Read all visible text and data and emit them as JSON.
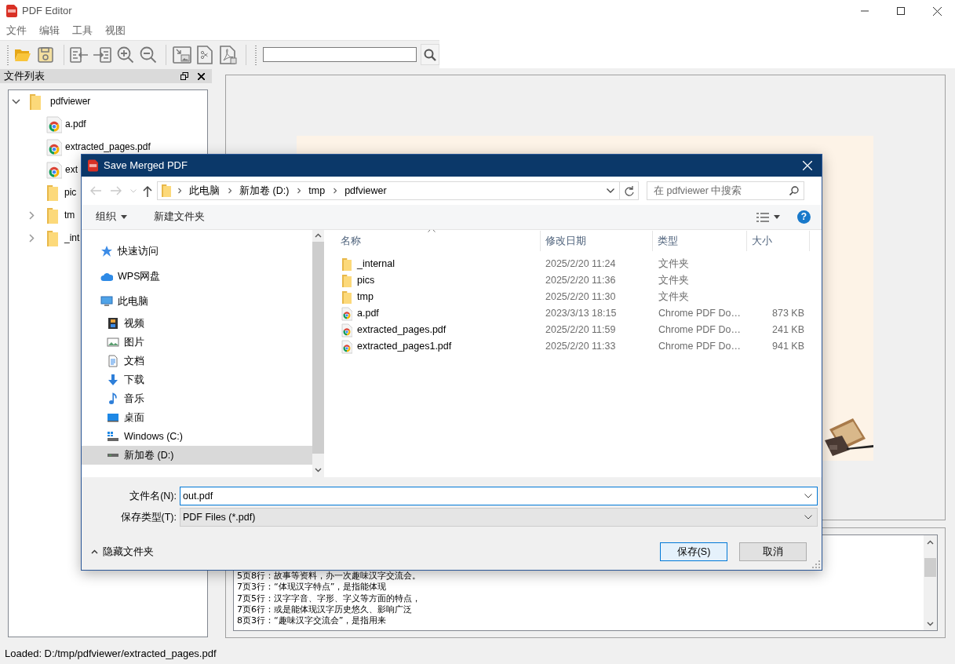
{
  "window": {
    "title": "PDF Editor"
  },
  "menu": [
    "文件",
    "编辑",
    "工具",
    "视图"
  ],
  "dock": {
    "title": "文件列表",
    "tree": [
      {
        "label": "pdfviewer",
        "kind": "folder",
        "expanded": true,
        "children": [
          {
            "label": "a.pdf",
            "kind": "pdf"
          },
          {
            "label": "extracted_pages.pdf",
            "kind": "pdf"
          },
          {
            "label": "ext",
            "kind": "pdf"
          },
          {
            "label": "pic",
            "kind": "folder"
          },
          {
            "label": "tm",
            "kind": "folder",
            "expanded": false
          },
          {
            "label": "_int",
            "kind": "folder",
            "expanded": false
          }
        ]
      }
    ]
  },
  "log": {
    "lines": [
      "5页8行：故事等资料，办一次趣味汉字交流会。",
      "7页3行：“体现汉字特点”，是指能体现",
      "7页5行：汉字字音、字形、字义等方面的特点，",
      "7页6行：或是能体现汉字历史悠久、影响广泛",
      "8页3行：“趣味汉字交流会”，是指用来"
    ]
  },
  "status_bar": "Loaded: D:/tmp/pdfviewer/extracted_pages.pdf",
  "dialog": {
    "title": "Save Merged PDF",
    "breadcrumb": [
      "此电脑",
      "新加卷 (D:)",
      "tmp",
      "pdfviewer"
    ],
    "search": {
      "placeholder": "在 pdfviewer 中搜索"
    },
    "commands": [
      {
        "label": "组织",
        "kind": "menu"
      },
      {
        "label": "新建文件夹",
        "kind": "button"
      }
    ],
    "help": "?",
    "nav": [
      {
        "label": "快速访问",
        "kind": "star",
        "selected": false
      },
      {
        "label": "WPS网盘",
        "kind": "cloud",
        "selected": false
      },
      {
        "label": "此电脑",
        "kind": "computer",
        "selected": false,
        "children": [
          {
            "label": "视频",
            "kind": "video",
            "selected": false
          },
          {
            "label": "图片",
            "kind": "picture",
            "selected": false
          },
          {
            "label": "文档",
            "kind": "document",
            "selected": false
          },
          {
            "label": "下载",
            "kind": "download",
            "selected": false
          },
          {
            "label": "音乐",
            "kind": "music",
            "selected": false
          },
          {
            "label": "桌面",
            "kind": "desktop",
            "selected": false
          },
          {
            "label": "Windows (C:)",
            "kind": "system-drive",
            "selected": false
          },
          {
            "label": "新加卷 (D:)",
            "kind": "drive",
            "selected": true
          }
        ]
      }
    ],
    "columns": [
      {
        "label": "名称",
        "sorted": true
      },
      {
        "label": "修改日期",
        "sorted": false
      },
      {
        "label": "类型",
        "sorted": false
      },
      {
        "label": "大小",
        "sorted": false
      }
    ],
    "files": [
      {
        "name": "_internal",
        "date": "2025/2/20 11:24",
        "type": "文件夹",
        "kind": "folder"
      },
      {
        "name": "pics",
        "date": "2025/2/20 11:36",
        "type": "文件夹",
        "kind": "folder"
      },
      {
        "name": "tmp",
        "date": "2025/2/20 11:30",
        "type": "文件夹",
        "kind": "folder"
      },
      {
        "name": "a.pdf",
        "date": "2023/3/13 18:15",
        "type": "Chrome PDF Do…",
        "size": "873 KB",
        "kind": "pdf"
      },
      {
        "name": "extracted_pages.pdf",
        "date": "2025/2/20 11:59",
        "type": "Chrome PDF Do…",
        "size": "241 KB",
        "kind": "pdf"
      },
      {
        "name": "extracted_pages1.pdf",
        "date": "2025/2/20 11:33",
        "type": "Chrome PDF Do…",
        "size": "941 KB",
        "kind": "pdf"
      }
    ],
    "filename": {
      "label": "文件名(N):",
      "value": "out.pdf"
    },
    "filetype": {
      "label": "保存类型(T):",
      "value": "PDF Files (*.pdf)"
    },
    "hide_folders": "隐藏文件夹",
    "buttons": [
      {
        "label": "保存(S)",
        "kind": "primary"
      },
      {
        "label": "取消",
        "kind": "secondary"
      }
    ]
  }
}
